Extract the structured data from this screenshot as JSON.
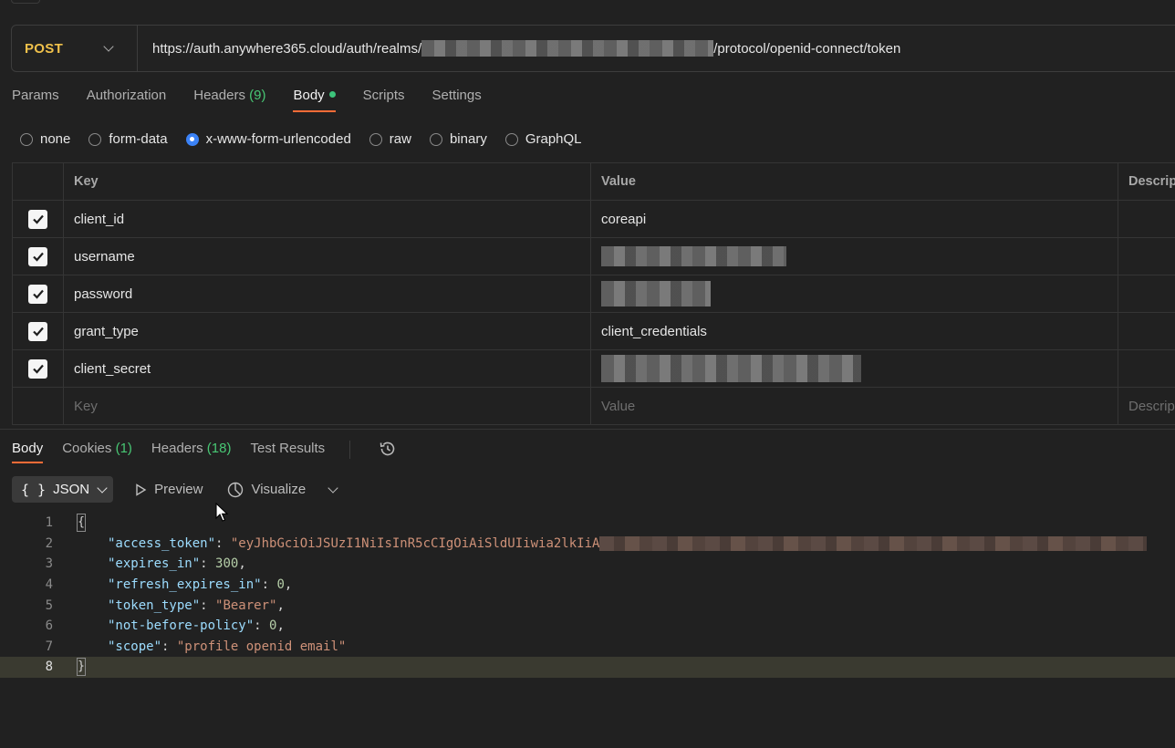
{
  "request": {
    "method": "POST",
    "url_prefix": "https://auth.anywhere365.cloud/auth/realms/",
    "url_suffix": "/protocol/openid-connect/token"
  },
  "request_tabs": [
    {
      "label": "Params"
    },
    {
      "label": "Authorization"
    },
    {
      "label": "Headers",
      "count": "(9)"
    },
    {
      "label": "Body"
    },
    {
      "label": "Scripts"
    },
    {
      "label": "Settings"
    }
  ],
  "body_types": [
    "none",
    "form-data",
    "x-www-form-urlencoded",
    "raw",
    "binary",
    "GraphQL"
  ],
  "body_type_selected": "x-www-form-urlencoded",
  "table": {
    "headers": {
      "key": "Key",
      "value": "Value",
      "description": "Descrip"
    },
    "rows": [
      {
        "key": "client_id",
        "value": "coreapi"
      },
      {
        "key": "username",
        "value": ""
      },
      {
        "key": "password",
        "value": ""
      },
      {
        "key": "grant_type",
        "value": "client_credentials"
      },
      {
        "key": "client_secret",
        "value": ""
      }
    ],
    "placeholders": {
      "key": "Key",
      "value": "Value",
      "description": "Descrip"
    }
  },
  "response_tabs": [
    {
      "label": "Body"
    },
    {
      "label": "Cookies",
      "count": "(1)"
    },
    {
      "label": "Headers",
      "count": "(18)"
    },
    {
      "label": "Test Results"
    }
  ],
  "toolbar": {
    "format": "JSON",
    "preview": "Preview",
    "visualize": "Visualize"
  },
  "response_json": {
    "open": "{",
    "close": "}",
    "access_token_key": "\"access_token\"",
    "access_token_value": "\"eyJhbGciOiJSUzI1NiIsInR5cCIgOiAiSldUIiwia2lkIiA",
    "expires_in_key": "\"expires_in\"",
    "expires_in_value": "300",
    "refresh_expires_in_key": "\"refresh_expires_in\"",
    "refresh_expires_in_value": "0",
    "token_type_key": "\"token_type\"",
    "token_type_value": "\"Bearer\"",
    "not_before_policy_key": "\"not-before-policy\"",
    "not_before_policy_value": "0",
    "scope_key": "\"scope\"",
    "scope_value": "\"profile openid email\"",
    "line_numbers": [
      "1",
      "2",
      "3",
      "4",
      "5",
      "6",
      "7",
      "8"
    ]
  }
}
